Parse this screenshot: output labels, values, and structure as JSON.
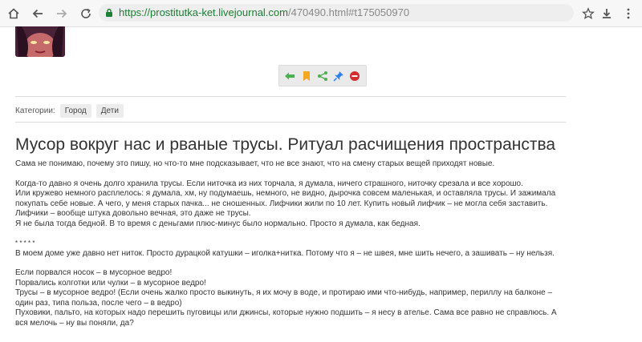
{
  "browser": {
    "url_domain": "https://prostitutka-ket.livejournal.com",
    "url_path": "/470490.html#t175050970"
  },
  "colors": {
    "accent": "#1e7e34",
    "share_green": "#4caf50",
    "share_orange": "#f5a623",
    "share_blue": "#2f80ed",
    "share_red": "#d32f2f"
  },
  "categories": {
    "label": "Категории:",
    "tags": [
      "Город",
      "Дети"
    ]
  },
  "post": {
    "title": "Мусор вокруг нас и рваные трусы. Ритуал расчищения пространства",
    "paragraphs": [
      [
        "Сама не понимаю, почему это пишу, но что-то мне подсказывает, что не все знают, что на смену старых вещей приходят новые."
      ],
      [
        "Когда-то давно я очень долго хранила трусы. Если ниточка из них торчала, я думала, ничего страшного, ниточку срезала и все хорошо.",
        "Или кружево немного расплелось: я думала, хм, ну подумаешь, немного, не видно, дырочка совсем маленькая, и оставляла трусы. И зажимала покупать себе новые. А чего, у меня старых пачка... не сношенных. Лифчики жили по 10 лет. Купить новый лифчик – не могла себя заставить. Лифчики – вообще штука довольно вечная, это даже не трусы.",
        "Я не была тогда бедной. В то время с деньгами плюс-минус было нормально. Просто я думала, как бедная."
      ],
      [
        "* * * * *",
        "В моем доме уже давно нет ниток. Просто дурацкой катушки – иголка+нитка. Потому что я – не швея, мне шить нечего, а зашивать – ну нельзя."
      ],
      [
        "Если порвался носок – в мусорное ведро!",
        "Порвались колготки или чулки – в мусорное ведро!",
        "Трусы – в мусорное ведро! (Если очень жалко просто выкинуть, я их мочу в воде, и протираю ими что-нибудь, например, периллу на балконе – один раз, типа польза, после чего – в ведро)",
        "Пуховики, пальто, на которых надо перешить пуговицы или джинсы, которые нужно подшить – я несу в ателье. Сама все равно не справлюсь. А вся мелочь – ну вы поняли, да?"
      ]
    ]
  }
}
